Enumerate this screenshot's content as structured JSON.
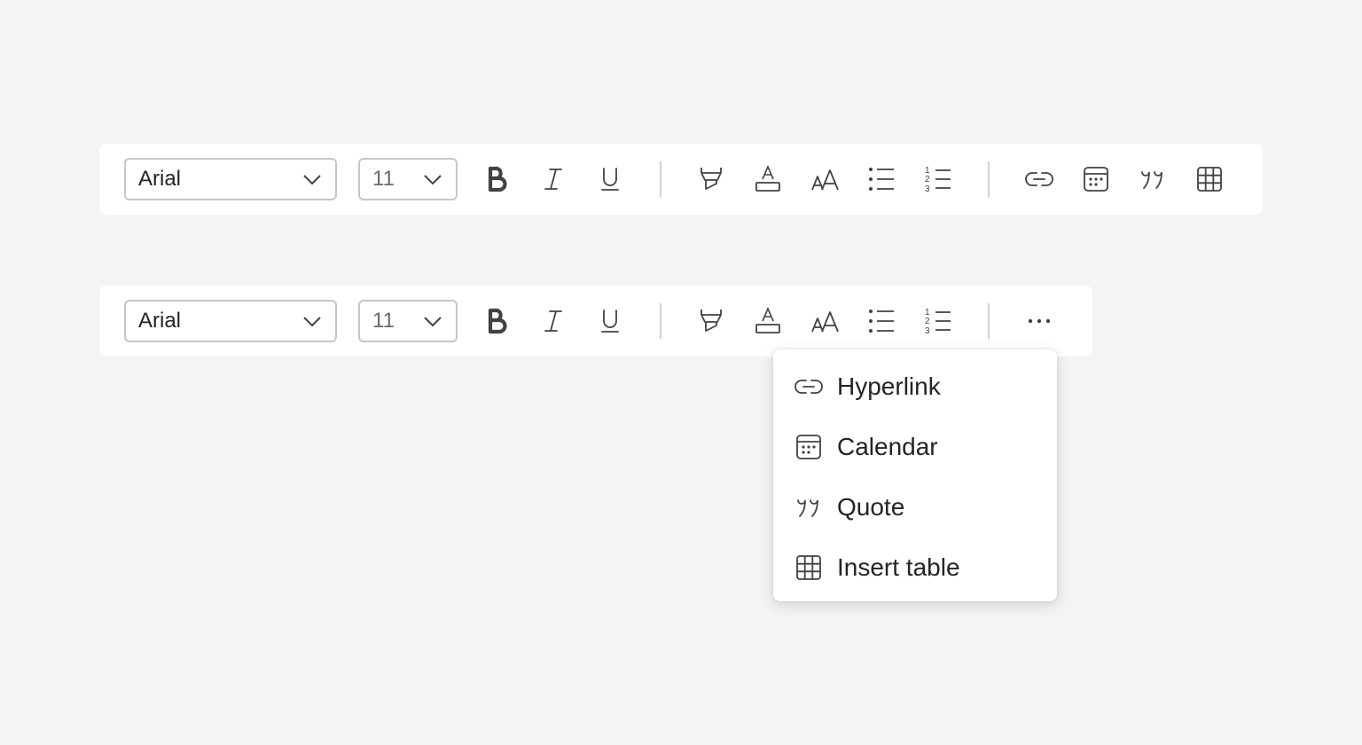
{
  "toolbar_full": {
    "font_family": "Arial",
    "font_size": "11",
    "buttons": [
      "bold-icon",
      "italic-icon",
      "underline-icon",
      "highlight-icon",
      "font-color-icon",
      "font-size-icon",
      "bullet-list-icon",
      "numbered-list-icon",
      "link-icon",
      "calendar-icon",
      "quote-icon",
      "table-icon"
    ]
  },
  "toolbar_compact": {
    "font_family": "Arial",
    "font_size": "11",
    "buttons": [
      "bold-icon",
      "italic-icon",
      "underline-icon",
      "highlight-icon",
      "font-color-icon",
      "font-size-icon",
      "bullet-list-icon",
      "numbered-list-icon",
      "more-icon"
    ]
  },
  "overflow_menu": {
    "items": [
      {
        "label": "Hyperlink",
        "icon": "link-icon"
      },
      {
        "label": "Calendar",
        "icon": "calendar-icon"
      },
      {
        "label": "Quote",
        "icon": "quote-icon"
      },
      {
        "label": "Insert table",
        "icon": "table-icon"
      }
    ]
  },
  "colors": {
    "background": "#f4f4f4",
    "surface": "#ffffff",
    "icon": "#424242",
    "text": "#242424",
    "border": "#c6c6c6",
    "divider": "#d1d1d1"
  }
}
